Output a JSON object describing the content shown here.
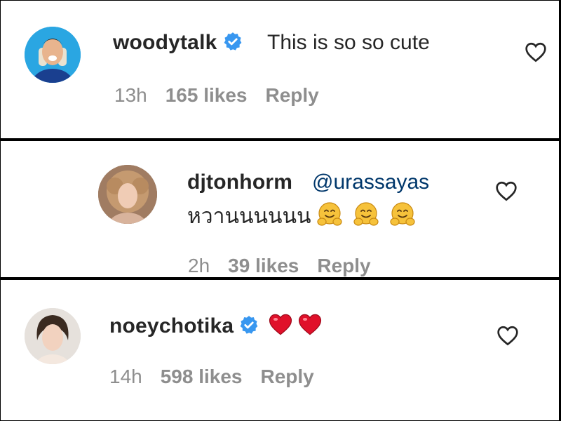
{
  "comments": [
    {
      "username": "woodytalk",
      "verified": true,
      "text": "This is so so cute",
      "time": "13h",
      "likes": "165 likes",
      "reply_label": "Reply",
      "like_icon": "heart-outline-icon"
    },
    {
      "username": "djtonhorm",
      "verified": false,
      "mention": "@urassayas",
      "text": "หวานนนนนน",
      "emojis": [
        "hugging-face-emoji",
        "hugging-face-emoji",
        "hugging-face-emoji"
      ],
      "time": "2h",
      "likes": "39 likes",
      "reply_label": "Reply",
      "like_icon": "heart-outline-icon"
    },
    {
      "username": "noeychotika",
      "verified": true,
      "emojis": [
        "red-heart-emoji",
        "red-heart-emoji"
      ],
      "time": "14h",
      "likes": "598 likes",
      "reply_label": "Reply",
      "like_icon": "heart-outline-icon"
    }
  ],
  "colors": {
    "text": "#262626",
    "meta": "#8e8e8e",
    "mention": "#00376b",
    "verified": "#3897f0",
    "heart_red": "#e0102a",
    "emoji_yellow": "#f6c23b"
  }
}
